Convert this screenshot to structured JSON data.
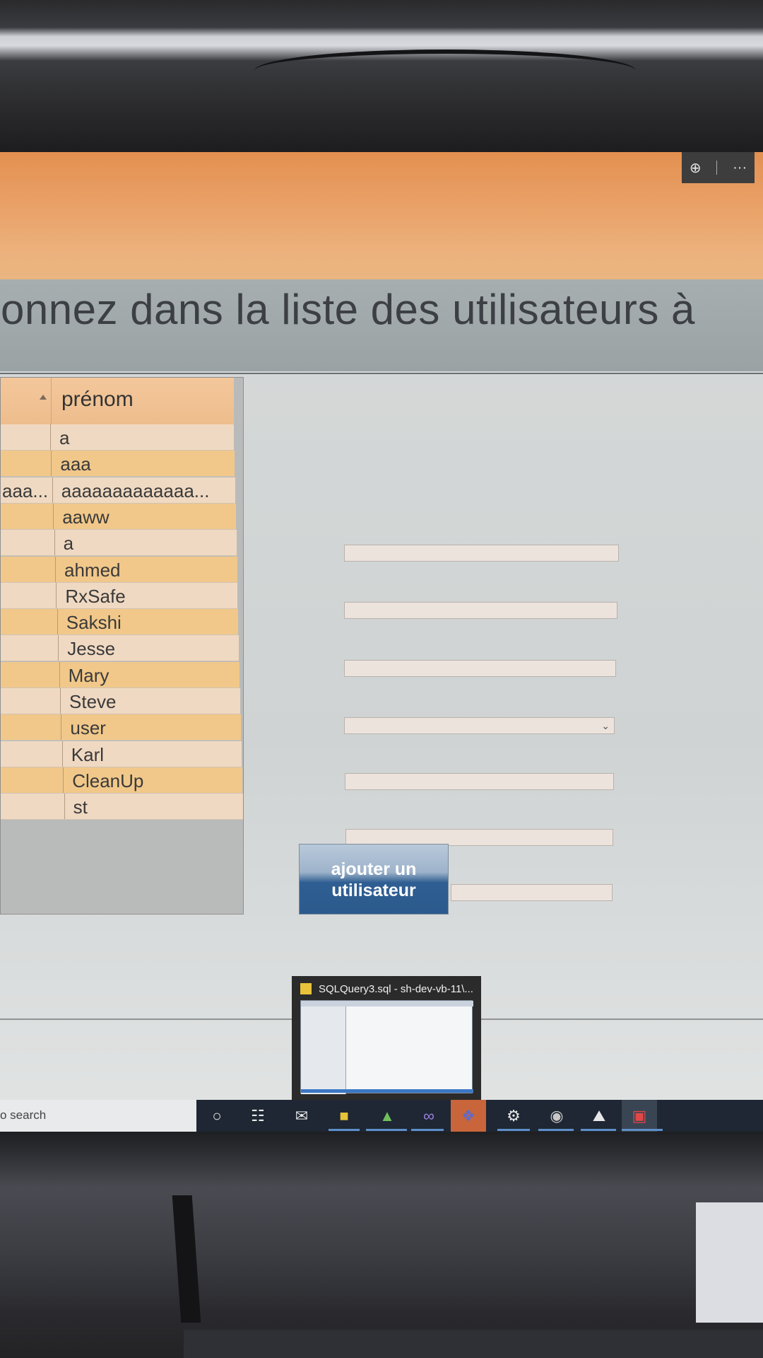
{
  "banner": {
    "zoom_icon": "zoom-in-icon",
    "more_icon": "more-dots-icon",
    "more_label": "···"
  },
  "page": {
    "heading": "tionnez dans la liste des utilisateurs à"
  },
  "grid": {
    "column_title": "prénom",
    "rows": [
      {
        "left": "",
        "prenom": "a"
      },
      {
        "left": "",
        "prenom": "aaa"
      },
      {
        "left": "aaa...",
        "prenom": "aaaaaaaaaaaaa..."
      },
      {
        "left": "",
        "prenom": "aaww"
      },
      {
        "left": "",
        "prenom": "a"
      },
      {
        "left": "",
        "prenom": "ahmed"
      },
      {
        "left": "",
        "prenom": "RxSafe"
      },
      {
        "left": "",
        "prenom": "Sakshi"
      },
      {
        "left": "",
        "prenom": "Jesse"
      },
      {
        "left": "",
        "prenom": "Mary"
      },
      {
        "left": "",
        "prenom": "Steve"
      },
      {
        "left": "",
        "prenom": "user"
      },
      {
        "left": "",
        "prenom": "Karl"
      },
      {
        "left": "",
        "prenom": "CleanUp"
      },
      {
        "left": "",
        "prenom": "st"
      }
    ]
  },
  "form": {
    "add_button_line1": "ajouter un",
    "add_button_line2": "utilisateur"
  },
  "preview": {
    "title": "SQLQuery3.sql - sh-dev-vb-11\\..."
  },
  "taskbar": {
    "search_text": "o search",
    "icons": [
      "cortana-icon",
      "task-view-icon",
      "mail-icon",
      "file-explorer-icon",
      "visual-studio-code-icon",
      "visual-studio-icon",
      "teams-icon",
      "settings-icon",
      "sql-server-icon",
      "photos-icon",
      "snipping-tool-icon"
    ]
  },
  "colors": {
    "banner": "#e9a066",
    "row_light": "#f0d9c2",
    "row_dark": "#f1c88a",
    "button_blue": "#2b5a8d",
    "taskbar": "#1e2733"
  }
}
